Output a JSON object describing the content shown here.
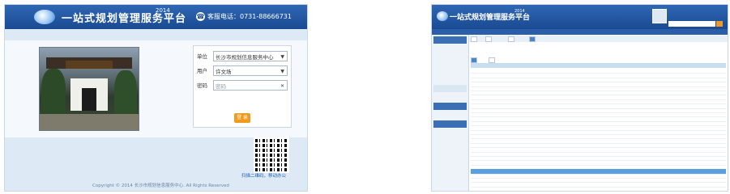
{
  "login": {
    "app_title": "一站式规划管理服务平台",
    "year": "2014",
    "phone_label": "客服电话：0731-88666731",
    "photo_sign": "城市规划",
    "form": {
      "unit_label": "单位",
      "unit_value": "长沙市规划信息服务中心",
      "user_label": "用户",
      "user_value": "许文场",
      "password_label": "密码",
      "password_placeholder": "密码"
    },
    "login_button": "登 录",
    "qr_caption": "扫描二维码，移动办公",
    "copyright": "Copyright © 2014 长沙市规划信息服务中心. All Rights Reserved"
  },
  "app": {
    "app_title": "一站式规划管理服务平台",
    "year": "2014",
    "top_links": "",
    "search_placeholder": "",
    "nav": [
      "",
      "",
      "",
      "",
      "",
      "",
      "",
      "",
      ""
    ],
    "side": [
      "",
      "",
      "",
      "",
      "",
      "",
      "",
      "",
      "",
      "",
      "",
      "",
      "",
      "",
      "",
      "",
      "",
      ""
    ],
    "tabs": [
      "",
      "",
      "",
      ""
    ],
    "toolbar_text": "",
    "subtitle_text": "",
    "subtabs": [
      "",
      ""
    ],
    "table_headers": [
      "",
      "",
      "",
      "",
      "",
      ""
    ],
    "days": [
      "",
      "",
      "",
      "",
      ""
    ],
    "rows": [
      [
        "",
        "",
        "",
        "",
        "",
        ""
      ]
    ]
  },
  "colors": {
    "brand_blue": "#1a4a93",
    "accent_orange": "#f29a1c",
    "highlight_row": "#5aa0e0"
  }
}
